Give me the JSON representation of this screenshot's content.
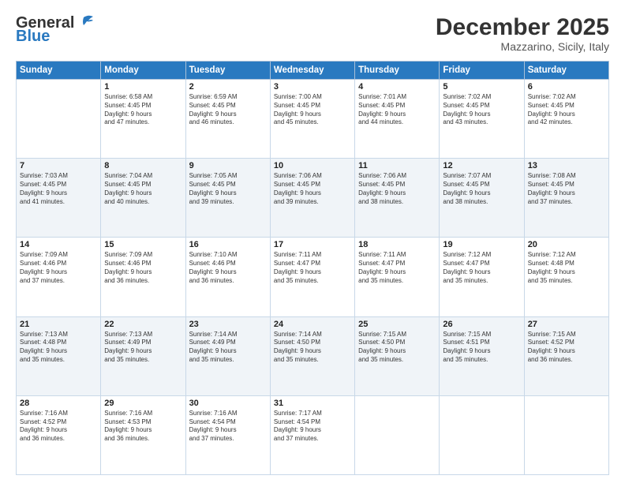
{
  "header": {
    "logo_general": "General",
    "logo_blue": "Blue",
    "month_title": "December 2025",
    "location": "Mazzarino, Sicily, Italy"
  },
  "columns": [
    "Sunday",
    "Monday",
    "Tuesday",
    "Wednesday",
    "Thursday",
    "Friday",
    "Saturday"
  ],
  "weeks": [
    {
      "shade": "white",
      "days": [
        {
          "num": "",
          "info": ""
        },
        {
          "num": "1",
          "info": "Sunrise: 6:58 AM\nSunset: 4:45 PM\nDaylight: 9 hours\nand 47 minutes."
        },
        {
          "num": "2",
          "info": "Sunrise: 6:59 AM\nSunset: 4:45 PM\nDaylight: 9 hours\nand 46 minutes."
        },
        {
          "num": "3",
          "info": "Sunrise: 7:00 AM\nSunset: 4:45 PM\nDaylight: 9 hours\nand 45 minutes."
        },
        {
          "num": "4",
          "info": "Sunrise: 7:01 AM\nSunset: 4:45 PM\nDaylight: 9 hours\nand 44 minutes."
        },
        {
          "num": "5",
          "info": "Sunrise: 7:02 AM\nSunset: 4:45 PM\nDaylight: 9 hours\nand 43 minutes."
        },
        {
          "num": "6",
          "info": "Sunrise: 7:02 AM\nSunset: 4:45 PM\nDaylight: 9 hours\nand 42 minutes."
        }
      ]
    },
    {
      "shade": "shaded",
      "days": [
        {
          "num": "7",
          "info": "Sunrise: 7:03 AM\nSunset: 4:45 PM\nDaylight: 9 hours\nand 41 minutes."
        },
        {
          "num": "8",
          "info": "Sunrise: 7:04 AM\nSunset: 4:45 PM\nDaylight: 9 hours\nand 40 minutes."
        },
        {
          "num": "9",
          "info": "Sunrise: 7:05 AM\nSunset: 4:45 PM\nDaylight: 9 hours\nand 39 minutes."
        },
        {
          "num": "10",
          "info": "Sunrise: 7:06 AM\nSunset: 4:45 PM\nDaylight: 9 hours\nand 39 minutes."
        },
        {
          "num": "11",
          "info": "Sunrise: 7:06 AM\nSunset: 4:45 PM\nDaylight: 9 hours\nand 38 minutes."
        },
        {
          "num": "12",
          "info": "Sunrise: 7:07 AM\nSunset: 4:45 PM\nDaylight: 9 hours\nand 38 minutes."
        },
        {
          "num": "13",
          "info": "Sunrise: 7:08 AM\nSunset: 4:45 PM\nDaylight: 9 hours\nand 37 minutes."
        }
      ]
    },
    {
      "shade": "white",
      "days": [
        {
          "num": "14",
          "info": "Sunrise: 7:09 AM\nSunset: 4:46 PM\nDaylight: 9 hours\nand 37 minutes."
        },
        {
          "num": "15",
          "info": "Sunrise: 7:09 AM\nSunset: 4:46 PM\nDaylight: 9 hours\nand 36 minutes."
        },
        {
          "num": "16",
          "info": "Sunrise: 7:10 AM\nSunset: 4:46 PM\nDaylight: 9 hours\nand 36 minutes."
        },
        {
          "num": "17",
          "info": "Sunrise: 7:11 AM\nSunset: 4:47 PM\nDaylight: 9 hours\nand 35 minutes."
        },
        {
          "num": "18",
          "info": "Sunrise: 7:11 AM\nSunset: 4:47 PM\nDaylight: 9 hours\nand 35 minutes."
        },
        {
          "num": "19",
          "info": "Sunrise: 7:12 AM\nSunset: 4:47 PM\nDaylight: 9 hours\nand 35 minutes."
        },
        {
          "num": "20",
          "info": "Sunrise: 7:12 AM\nSunset: 4:48 PM\nDaylight: 9 hours\nand 35 minutes."
        }
      ]
    },
    {
      "shade": "shaded",
      "days": [
        {
          "num": "21",
          "info": "Sunrise: 7:13 AM\nSunset: 4:48 PM\nDaylight: 9 hours\nand 35 minutes."
        },
        {
          "num": "22",
          "info": "Sunrise: 7:13 AM\nSunset: 4:49 PM\nDaylight: 9 hours\nand 35 minutes."
        },
        {
          "num": "23",
          "info": "Sunrise: 7:14 AM\nSunset: 4:49 PM\nDaylight: 9 hours\nand 35 minutes."
        },
        {
          "num": "24",
          "info": "Sunrise: 7:14 AM\nSunset: 4:50 PM\nDaylight: 9 hours\nand 35 minutes."
        },
        {
          "num": "25",
          "info": "Sunrise: 7:15 AM\nSunset: 4:50 PM\nDaylight: 9 hours\nand 35 minutes."
        },
        {
          "num": "26",
          "info": "Sunrise: 7:15 AM\nSunset: 4:51 PM\nDaylight: 9 hours\nand 35 minutes."
        },
        {
          "num": "27",
          "info": "Sunrise: 7:15 AM\nSunset: 4:52 PM\nDaylight: 9 hours\nand 36 minutes."
        }
      ]
    },
    {
      "shade": "white",
      "days": [
        {
          "num": "28",
          "info": "Sunrise: 7:16 AM\nSunset: 4:52 PM\nDaylight: 9 hours\nand 36 minutes."
        },
        {
          "num": "29",
          "info": "Sunrise: 7:16 AM\nSunset: 4:53 PM\nDaylight: 9 hours\nand 36 minutes."
        },
        {
          "num": "30",
          "info": "Sunrise: 7:16 AM\nSunset: 4:54 PM\nDaylight: 9 hours\nand 37 minutes."
        },
        {
          "num": "31",
          "info": "Sunrise: 7:17 AM\nSunset: 4:54 PM\nDaylight: 9 hours\nand 37 minutes."
        },
        {
          "num": "",
          "info": ""
        },
        {
          "num": "",
          "info": ""
        },
        {
          "num": "",
          "info": ""
        }
      ]
    }
  ]
}
